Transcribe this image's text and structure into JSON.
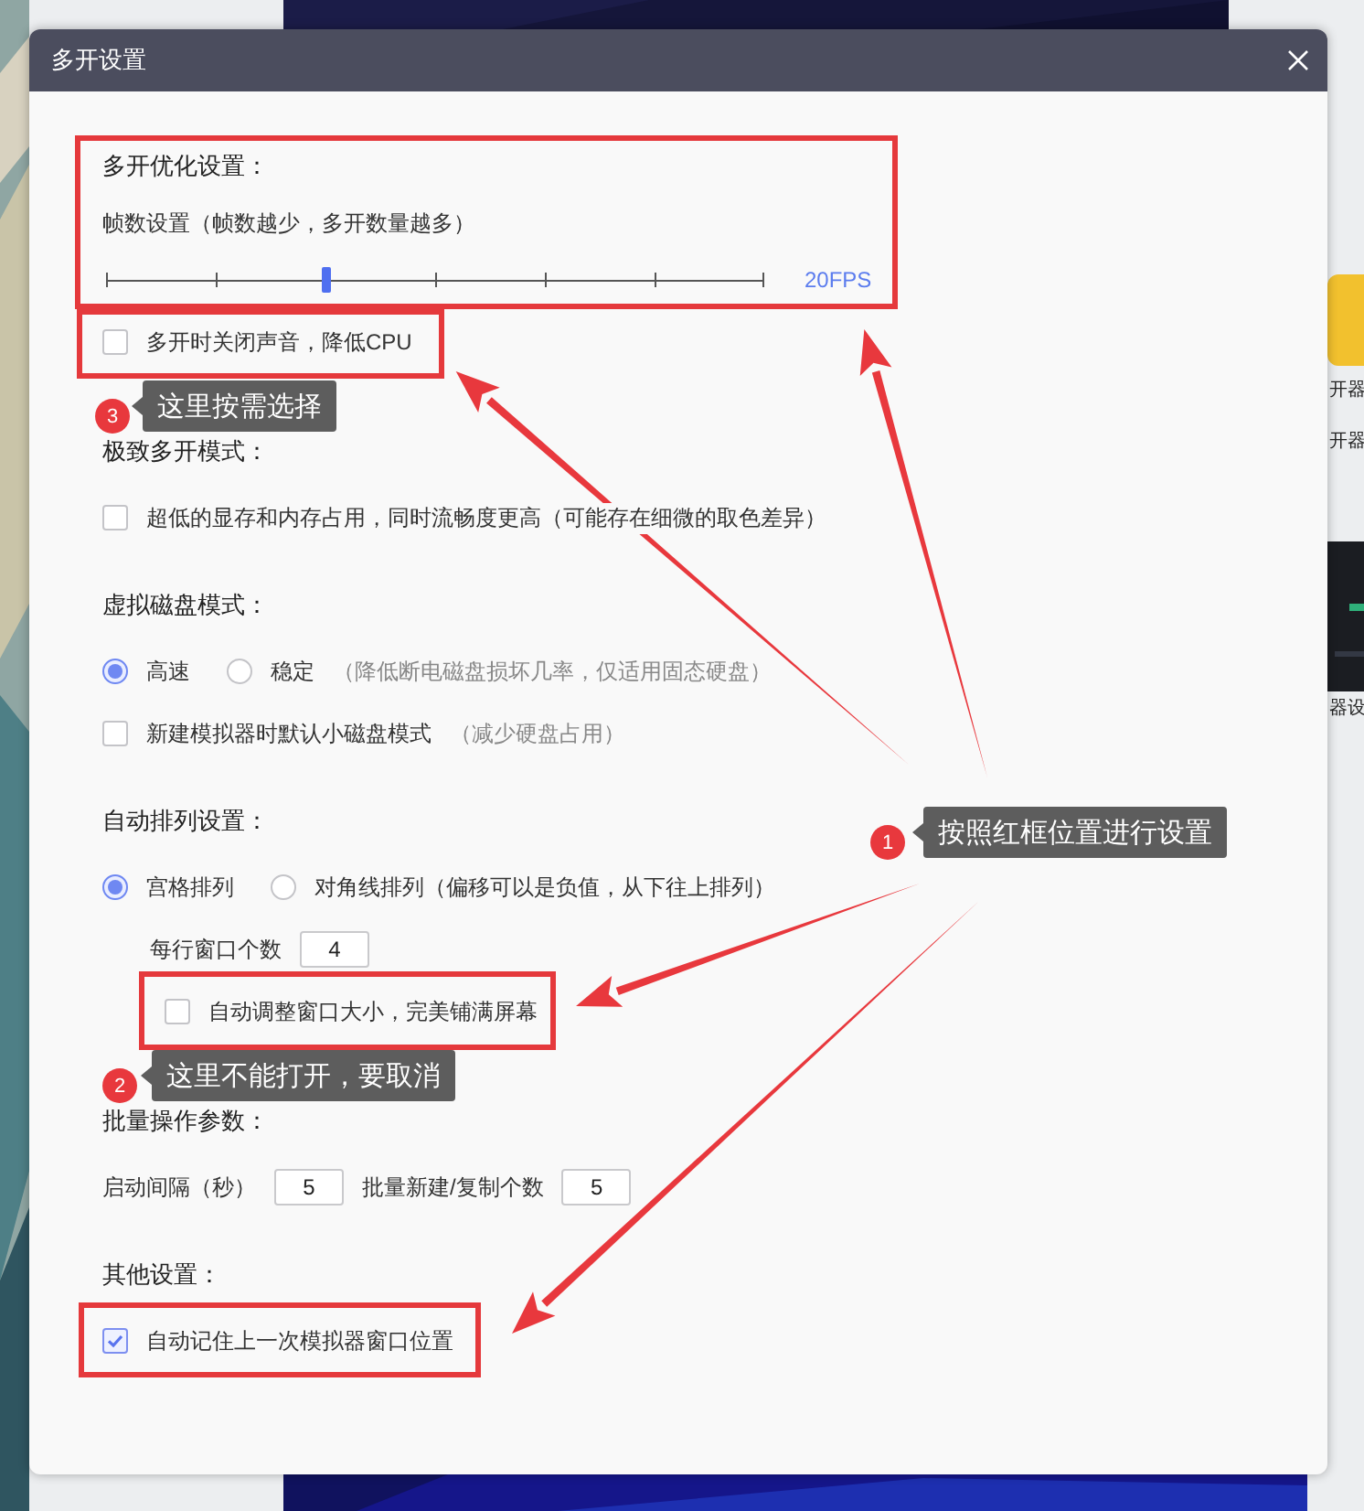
{
  "dialog": {
    "title": "多开设置",
    "sections": [
      {
        "title": "多开优化设置：",
        "items": [
          {
            "kind": "caption",
            "text": "帧数设置（帧数越少，多开数量越多）"
          },
          {
            "kind": "slider",
            "level": 0.333,
            "reading": "20FPS"
          },
          {
            "kind": "checkbox",
            "label": "多开时关闭声音，降低CPU",
            "checked": false
          }
        ]
      },
      {
        "title": "极致多开模式：",
        "items": [
          {
            "kind": "checkbox",
            "label": "超低的显存和内存占用，同时流畅度更高（可能存在细微的取色差异）",
            "checked": false
          }
        ]
      },
      {
        "title": "虚拟磁盘模式：",
        "items": [
          {
            "kind": "radios",
            "options": [
              {
                "label": "高速",
                "selected": true
              },
              {
                "label": "稳定",
                "hint": "（降低断电磁盘损坏几率，仅适用固态硬盘）",
                "selected": false
              }
            ]
          },
          {
            "kind": "checkbox",
            "label": "新建模拟器时默认小磁盘模式",
            "hint": "（减少硬盘占用）",
            "checked": false
          }
        ]
      },
      {
        "title": "自动排列设置：",
        "items": [
          {
            "kind": "radios",
            "options": [
              {
                "label": "宫格排列",
                "selected": true,
                "children": [
                  {
                    "kind": "fields",
                    "fields": [
                      {
                        "label": "每行窗口个数",
                        "value": "4"
                      }
                    ]
                  },
                  {
                    "kind": "checkbox",
                    "label": "自动调整窗口大小，完美铺满屏幕",
                    "checked": false
                  }
                ]
              },
              {
                "label": "对角线排列（偏移可以是负值，从下往上排列）",
                "selected": false
              }
            ]
          }
        ]
      },
      {
        "title": "批量操作参数：",
        "items": [
          {
            "kind": "fields",
            "fields": [
              {
                "label": "启动间隔（秒）",
                "value": "5"
              },
              {
                "label": "批量新建/复制个数",
                "value": "5"
              }
            ]
          }
        ]
      },
      {
        "title": "其他设置：",
        "items": [
          {
            "kind": "checkbox",
            "label": "自动记住上一次模拟器窗口位置",
            "checked": true
          }
        ]
      }
    ]
  },
  "callouts": [
    {
      "number": "3",
      "text": "这里按需选择"
    },
    {
      "number": "1",
      "text": "按照红框位置进行设置"
    },
    {
      "number": "2",
      "text": "这里不能打开，要取消"
    }
  ],
  "background_labels": [
    "开器",
    "开器",
    "器设"
  ]
}
